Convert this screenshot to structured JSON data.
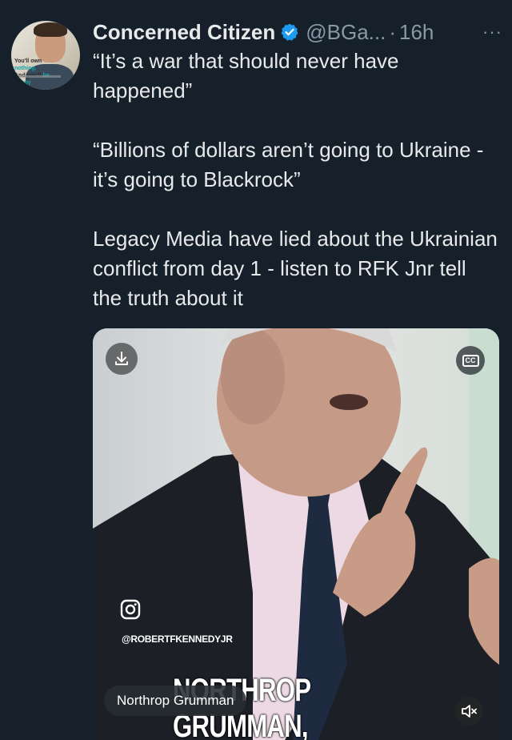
{
  "tweet": {
    "author_name": "Concerned Citizen",
    "handle": "@BGa...",
    "separator": "·",
    "time": "16h",
    "more_label": "···",
    "verified_color": "#1d9bf0",
    "paragraphs": [
      "“It’s a war that should never have happened”",
      "“Billions of dollars aren’t going to Ukraine - it’s going to Blackrock”",
      "Legacy Media have lied about the Ukrainian conflict from day 1 - listen to RFK Jnr tell the truth about it"
    ]
  },
  "avatar": {
    "caption_line1_a": "You'll own ",
    "caption_line1_b": "nothing.",
    "caption_line2_a": "And you'll ",
    "caption_line2_b": "be happy"
  },
  "video": {
    "cc_label": "CC",
    "watermark": "@ROBERTFKENNEDYJR",
    "subtitle": "NORTHROP GRUMMAN,",
    "alt_label": "Northrop Grumman",
    "icons": [
      "download-icon",
      "closed-captions-icon",
      "instagram-icon",
      "mute-icon"
    ]
  },
  "colors": {
    "background": "#15202b",
    "text": "#e7e9ea",
    "secondary_text": "#8b98a5"
  }
}
